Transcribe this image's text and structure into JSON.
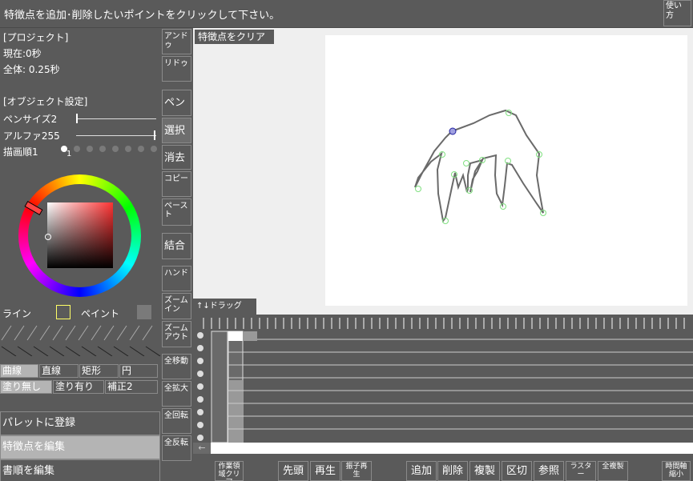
{
  "top": {
    "message": "特徴点を追加･削除したいポイントをクリックして下さい。",
    "help_label": "使い方"
  },
  "project": {
    "header": "[プロジェクト]",
    "current": "現在:0秒",
    "total": "全体: 0.25秒"
  },
  "object": {
    "header": "[オブジェクト設定]",
    "pen_size": "ペンサイズ2",
    "alpha": "アルファ255",
    "draw_order": "描画順1",
    "draw_order_index": "1"
  },
  "color": {
    "line_label": "ライン",
    "paint_label": "ペイント",
    "line_color": "#ffff66",
    "paint_color": "#7a7a7a"
  },
  "shapes": {
    "curve": "曲線",
    "straight": "直線",
    "rect": "矩形",
    "circle": "円",
    "no_fill": "塗り無し",
    "fill": "塗り有り",
    "correction": "補正2"
  },
  "actions": {
    "register_palette": "パレットに登録",
    "edit_feature": "特徴点を編集",
    "edit_order": "書順を編集"
  },
  "tools": {
    "undo": "アンドゥ",
    "redo": "リドゥ",
    "pen": "ペン",
    "select": "選択",
    "erase": "消去",
    "copy": "コピー",
    "paste": "ペースト",
    "join": "結合",
    "hand": "ハンド",
    "zoom_in": "ズームイン",
    "zoom_out": "ズームアウト",
    "move_all": "全移動",
    "enlarge_all": "全拡大",
    "rotate_all": "全回転",
    "flip_all": "全反転"
  },
  "canvas": {
    "clear_label": "特徴点をクリア",
    "drag_label": "↑↓ドラッグ"
  },
  "timeline": {
    "back_label": "←"
  },
  "bottom": {
    "clear_work": "作業領域クリア",
    "first": "先頭",
    "play": "再生",
    "swing_play": "振子再生",
    "add": "追加",
    "delete": "削除",
    "duplicate": "複製",
    "cut": "区切",
    "reference": "参照",
    "raster": "ラスター",
    "copy_all": "全複製",
    "time_axis_shrink": "時間軸縮小"
  }
}
